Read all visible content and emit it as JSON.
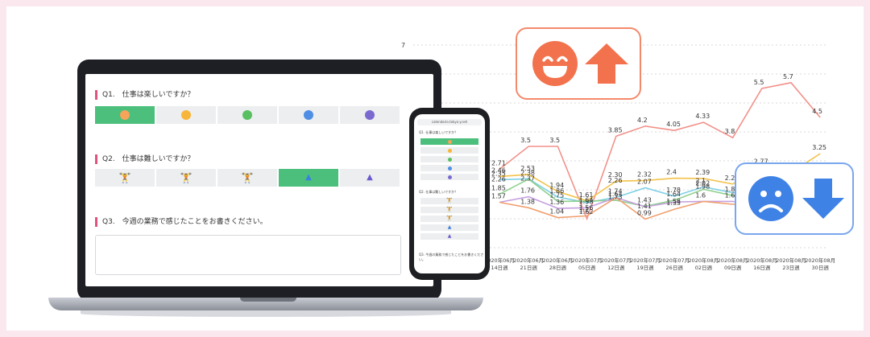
{
  "laptop": {
    "q1": "Q1.　仕事は楽しいですか？",
    "q2": "Q2.　仕事は難しいですか？",
    "q3": "Q3.　今週の業務で感じたことをお書きください。",
    "q1_options": [
      "face-very-happy-icon",
      "face-happy-icon",
      "face-neutral-icon",
      "face-sad-icon",
      "face-very-sad-icon"
    ],
    "q1_colors": [
      "#f5a45a",
      "#f7b63a",
      "#58c060",
      "#4e8ee5",
      "#7a6ad0"
    ],
    "q1_selected": 0,
    "q2_options": [
      "figure-lifting-light-icon",
      "figure-lifting-icon",
      "figure-lifting-heavy-icon",
      "figure-group-icon",
      "figure-group-small-icon"
    ],
    "q2_colors": [
      "#f08030",
      "#f4a020",
      "#3caa5a",
      "#3c7fe0",
      "#6a5ad0"
    ],
    "q2_selected": 3
  },
  "phone": {
    "url": "calendario.tokyo-y.net",
    "q1": "Q1. 仕事は楽しいですか？",
    "q2": "Q2. 仕事は難しいですか？",
    "q3": "Q3. 今週の業務で感じたことをお書きください。"
  },
  "cards": {
    "happy": {
      "icon": "grinning-face-up-arrow-icon",
      "color": "#f3724e"
    },
    "sad": {
      "icon": "sad-face-down-arrow-icon",
      "color": "#3f82e6"
    }
  },
  "chart_data": {
    "type": "line",
    "categories": [
      "2020年06月\n14日週",
      "2020年06月\n21日週",
      "2020年06月\n28日週",
      "2020年07月\n05日週",
      "2020年07月\n12日週",
      "2020年07月\n19日週",
      "2020年07月\n26日週",
      "2020年08月\n02日週",
      "2020年08月\n09日週",
      "2020年08月\n16日週",
      "2020年08月\n23日週",
      "2020年08月\n30日週"
    ],
    "ytick": "7",
    "series": [
      {
        "color": "#f2918a",
        "values": [
          2.71,
          3.5,
          3.5,
          1.0,
          3.85,
          4.2,
          4.05,
          4.33,
          3.8,
          5.5,
          5.7,
          4.5
        ]
      },
      {
        "color": "#f3c24a",
        "values": [
          2.46,
          2.53,
          1.94,
          1.62,
          2.3,
          2.32,
          2.4,
          2.39,
          2.2,
          2.77,
          2.6,
          3.25
        ]
      },
      {
        "color": "#7fd0e6",
        "values": [
          2.35,
          2.38,
          1.75,
          1.56,
          1.74,
          2.07,
          1.78,
          2.1,
          1.9,
          2.1,
          2.3,
          2.06
        ]
      },
      {
        "color": "#8fd08e",
        "values": [
          1.85,
          2.37,
          1.6,
          1.61,
          1.64,
          1.43,
          1.64,
          2.02,
          1.8,
          1.6,
          1.9,
          1.6
        ]
      },
      {
        "color": "#c6a0e0",
        "values": [
          1.57,
          1.76,
          1.36,
          1.38,
          1.73,
          1.41,
          1.58,
          1.6,
          1.6,
          1.42,
          1.2,
          1.29
        ]
      },
      {
        "color": "#f0a070",
        "values": [
          1.57,
          1.38,
          1.04,
          1.1,
          1.73,
          0.99,
          1.33,
          1.6,
          1.5,
          1.5,
          1.1,
          0.96
        ]
      }
    ],
    "labels": [
      {
        "text": "2.71",
        "series": 0,
        "i": 0
      },
      {
        "text": "2.46",
        "series": 1,
        "i": 0
      },
      {
        "text": "2.35",
        "series": 2,
        "i": 0
      },
      {
        "text": "2.26",
        "series": 2,
        "i": 0
      },
      {
        "text": "1.85",
        "series": 3,
        "i": 0
      },
      {
        "text": "1.57",
        "series": 4,
        "i": 0
      },
      {
        "text": "3.5",
        "series": 0,
        "i": 1
      },
      {
        "text": "2.53",
        "series": 1,
        "i": 1
      },
      {
        "text": "2.38",
        "series": 2,
        "i": 1
      },
      {
        "text": "2.37",
        "series": 3,
        "i": 1
      },
      {
        "text": "1.76",
        "series": 4,
        "i": 1
      },
      {
        "text": "1.38",
        "series": 5,
        "i": 1
      },
      {
        "text": "3.5",
        "series": 0,
        "i": 2
      },
      {
        "text": "1.94",
        "series": 1,
        "i": 2
      },
      {
        "text": "1.86",
        "series": 2,
        "i": 2
      },
      {
        "text": "1.75",
        "series": 3,
        "i": 2
      },
      {
        "text": "1.36",
        "series": 4,
        "i": 2
      },
      {
        "text": "1.04",
        "series": 5,
        "i": 2
      },
      {
        "text": "1.61",
        "series": 3,
        "i": 3
      },
      {
        "text": "1.64",
        "series": 1,
        "i": 3
      },
      {
        "text": "1.56",
        "series": 2,
        "i": 3
      },
      {
        "text": "1.62",
        "series": 3,
        "i": 3
      },
      {
        "text": "1.38",
        "series": 4,
        "i": 3
      },
      {
        "text": "1.1",
        "series": 5,
        "i": 3
      },
      {
        "text": "3.85",
        "series": 0,
        "i": 4
      },
      {
        "text": "2.30",
        "series": 1,
        "i": 4
      },
      {
        "text": "2.26",
        "series": 1,
        "i": 4
      },
      {
        "text": "1.74",
        "series": 2,
        "i": 4
      },
      {
        "text": "1.64",
        "series": 3,
        "i": 4
      },
      {
        "text": "1.73",
        "series": 4,
        "i": 4
      },
      {
        "text": "4.2",
        "series": 0,
        "i": 5
      },
      {
        "text": "2.32",
        "series": 1,
        "i": 5
      },
      {
        "text": "2.07",
        "series": 2,
        "i": 5
      },
      {
        "text": "1.43",
        "series": 3,
        "i": 5
      },
      {
        "text": "1.41",
        "series": 4,
        "i": 5
      },
      {
        "text": "0.99",
        "series": 5,
        "i": 5
      },
      {
        "text": "4.05",
        "series": 0,
        "i": 6
      },
      {
        "text": "2.4",
        "series": 1,
        "i": 6
      },
      {
        "text": "1.78",
        "series": 2,
        "i": 6
      },
      {
        "text": "1.64",
        "series": 3,
        "i": 6
      },
      {
        "text": "1.58",
        "series": 4,
        "i": 6
      },
      {
        "text": "1.33",
        "series": 5,
        "i": 6
      },
      {
        "text": "4.33",
        "series": 0,
        "i": 7
      },
      {
        "text": "2.39",
        "series": 1,
        "i": 7
      },
      {
        "text": "2.1",
        "series": 2,
        "i": 7
      },
      {
        "text": "1.98",
        "series": 2,
        "i": 7
      },
      {
        "text": "2.02",
        "series": 3,
        "i": 7
      },
      {
        "text": "1.6",
        "series": 4,
        "i": 7
      },
      {
        "text": "3.8",
        "series": 0,
        "i": 8
      },
      {
        "text": "2.2",
        "series": 1,
        "i": 8
      },
      {
        "text": "1.8",
        "series": 3,
        "i": 8
      },
      {
        "text": "1.6",
        "series": 4,
        "i": 8
      },
      {
        "text": "5.5",
        "series": 0,
        "i": 9
      },
      {
        "text": "2.77",
        "series": 1,
        "i": 9
      },
      {
        "text": "1.42",
        "series": 4,
        "i": 9
      },
      {
        "text": "5.7",
        "series": 0,
        "i": 10
      },
      {
        "text": "4.5",
        "series": 0,
        "i": 11
      },
      {
        "text": "3.25",
        "series": 1,
        "i": 11
      },
      {
        "text": "2.06",
        "series": 2,
        "i": 11
      },
      {
        "text": "1.29",
        "series": 4,
        "i": 11
      },
      {
        "text": "0.96",
        "series": 5,
        "i": 11
      }
    ]
  }
}
